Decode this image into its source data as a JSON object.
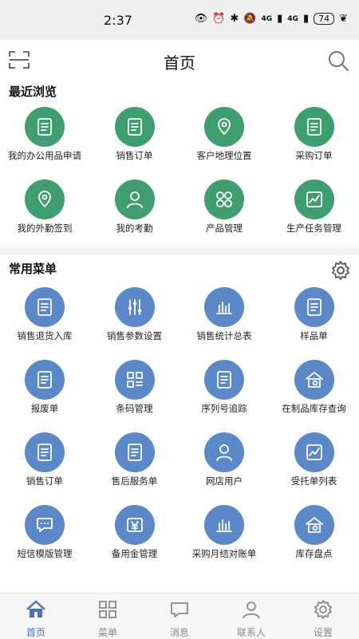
{
  "status": {
    "time": "2:37",
    "net1": "4G",
    "net2": "4G",
    "battery": "74"
  },
  "nav": {
    "title": "首页"
  },
  "recent": {
    "title": "最近浏览",
    "items": [
      {
        "label": "我的办公用品申请",
        "icon": "office-supplies-icon"
      },
      {
        "label": "销售订单",
        "icon": "sales-order-icon"
      },
      {
        "label": "客户地理位置",
        "icon": "location-icon"
      },
      {
        "label": "采购订单",
        "icon": "purchase-order-icon"
      },
      {
        "label": "我的外勤签到",
        "icon": "checkin-location-icon"
      },
      {
        "label": "我的考勤",
        "icon": "attendance-icon"
      },
      {
        "label": "产品管理",
        "icon": "product-grid-icon"
      },
      {
        "label": "生产任务管理",
        "icon": "production-task-icon"
      }
    ]
  },
  "menu": {
    "title": "常用菜单",
    "items": [
      {
        "label": "销售退货入库",
        "icon": "return-clipboard-icon"
      },
      {
        "label": "销售参数设置",
        "icon": "sliders-icon"
      },
      {
        "label": "销售统计总表",
        "icon": "bar-chart-icon"
      },
      {
        "label": "样品单",
        "icon": "sample-list-icon"
      },
      {
        "label": "报废单",
        "icon": "scrap-doc-icon"
      },
      {
        "label": "条码管理",
        "icon": "qrcode-icon"
      },
      {
        "label": "序列号追踪",
        "icon": "serial-search-icon"
      },
      {
        "label": "在制品库存查询",
        "icon": "warehouse-search-icon"
      },
      {
        "label": "销售订单",
        "icon": "sales-order-icon"
      },
      {
        "label": "售后服务单",
        "icon": "service-doc-icon"
      },
      {
        "label": "网店用户",
        "icon": "user-icon"
      },
      {
        "label": "受托单列表",
        "icon": "entrusted-list-icon"
      },
      {
        "label": "短信模版管理",
        "icon": "message-icon"
      },
      {
        "label": "备用金管理",
        "icon": "yen-icon"
      },
      {
        "label": "采购月结对账单",
        "icon": "bar-chart-icon"
      },
      {
        "label": "库存盘点",
        "icon": "warehouse-icon"
      }
    ]
  },
  "tabs": [
    {
      "label": "首页",
      "icon": "home-icon",
      "active": true
    },
    {
      "label": "菜单",
      "icon": "menu-grid-icon",
      "active": false
    },
    {
      "label": "消息",
      "icon": "message-bubble-icon",
      "active": false
    },
    {
      "label": "联系人",
      "icon": "contacts-icon",
      "active": false
    },
    {
      "label": "设置",
      "icon": "settings-icon",
      "active": false
    }
  ],
  "colors": {
    "green": "#3e9e6f",
    "blue": "#5b88c9",
    "active_tab": "#4a6fc6"
  }
}
